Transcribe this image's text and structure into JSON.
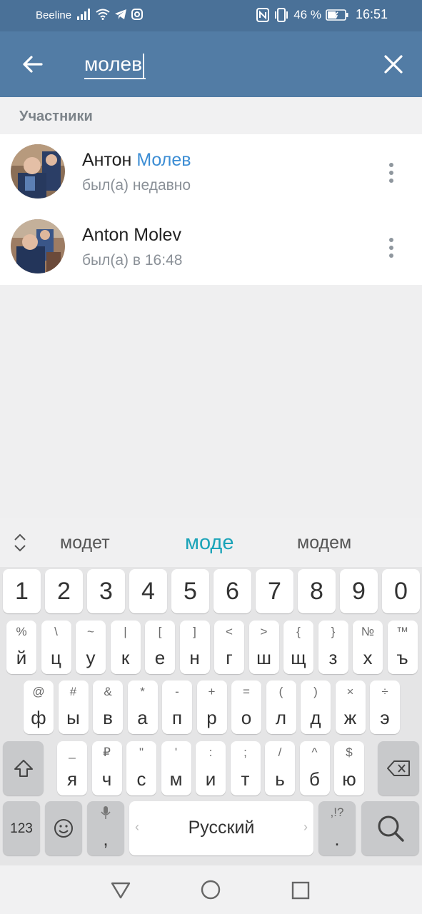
{
  "status": {
    "carrier": "Beeline",
    "battery": "46 %",
    "time": "16:51"
  },
  "search": {
    "query": "молев"
  },
  "section_title": "Участники",
  "results": [
    {
      "name_plain": "Антон ",
      "name_highlight": "Молев",
      "status": "был(а) недавно"
    },
    {
      "name_plain": "Anton Molev",
      "name_highlight": "",
      "status": "был(а) в 16:48"
    }
  ],
  "keyboard": {
    "suggestions": [
      "модет",
      "моде",
      "модем"
    ],
    "numbers": [
      "1",
      "2",
      "3",
      "4",
      "5",
      "6",
      "7",
      "8",
      "9",
      "0"
    ],
    "row1": [
      {
        "top": "%",
        "main": "й"
      },
      {
        "top": "\\",
        "main": "ц"
      },
      {
        "top": "~",
        "main": "у"
      },
      {
        "top": "|",
        "main": "к"
      },
      {
        "top": "[",
        "main": "е"
      },
      {
        "top": "]",
        "main": "н"
      },
      {
        "top": "<",
        "main": "г"
      },
      {
        "top": ">",
        "main": "ш"
      },
      {
        "top": "{",
        "main": "щ"
      },
      {
        "top": "}",
        "main": "з"
      },
      {
        "top": "№",
        "main": "х"
      },
      {
        "top": "™",
        "main": "ъ"
      }
    ],
    "row2": [
      {
        "top": "@",
        "main": "ф"
      },
      {
        "top": "#",
        "main": "ы"
      },
      {
        "top": "&",
        "main": "в"
      },
      {
        "top": "*",
        "main": "а"
      },
      {
        "top": "-",
        "main": "п"
      },
      {
        "top": "+",
        "main": "р"
      },
      {
        "top": "=",
        "main": "о"
      },
      {
        "top": "(",
        "main": "л"
      },
      {
        "top": ")",
        "main": "д"
      },
      {
        "top": "×",
        "main": "ж"
      },
      {
        "top": "÷",
        "main": "э"
      }
    ],
    "row3": [
      {
        "top": "_",
        "main": "я"
      },
      {
        "top": "₽",
        "main": "ч"
      },
      {
        "top": "\"",
        "main": "с"
      },
      {
        "top": "'",
        "main": "м"
      },
      {
        "top": ":",
        "main": "и"
      },
      {
        "top": ";",
        "main": "т"
      },
      {
        "top": "/",
        "main": "ь"
      },
      {
        "top": "^",
        "main": "б"
      },
      {
        "top": "$",
        "main": "ю"
      }
    ],
    "mode_label": "123",
    "comma_label": ",",
    "space_label": "Русский",
    "period_top": ",!?",
    "period_label": "."
  },
  "colors": {
    "header": "#527ca5",
    "statusbar": "#4a7198",
    "highlight": "#3c8dd4",
    "suggestion_active": "#1aa3b8"
  }
}
